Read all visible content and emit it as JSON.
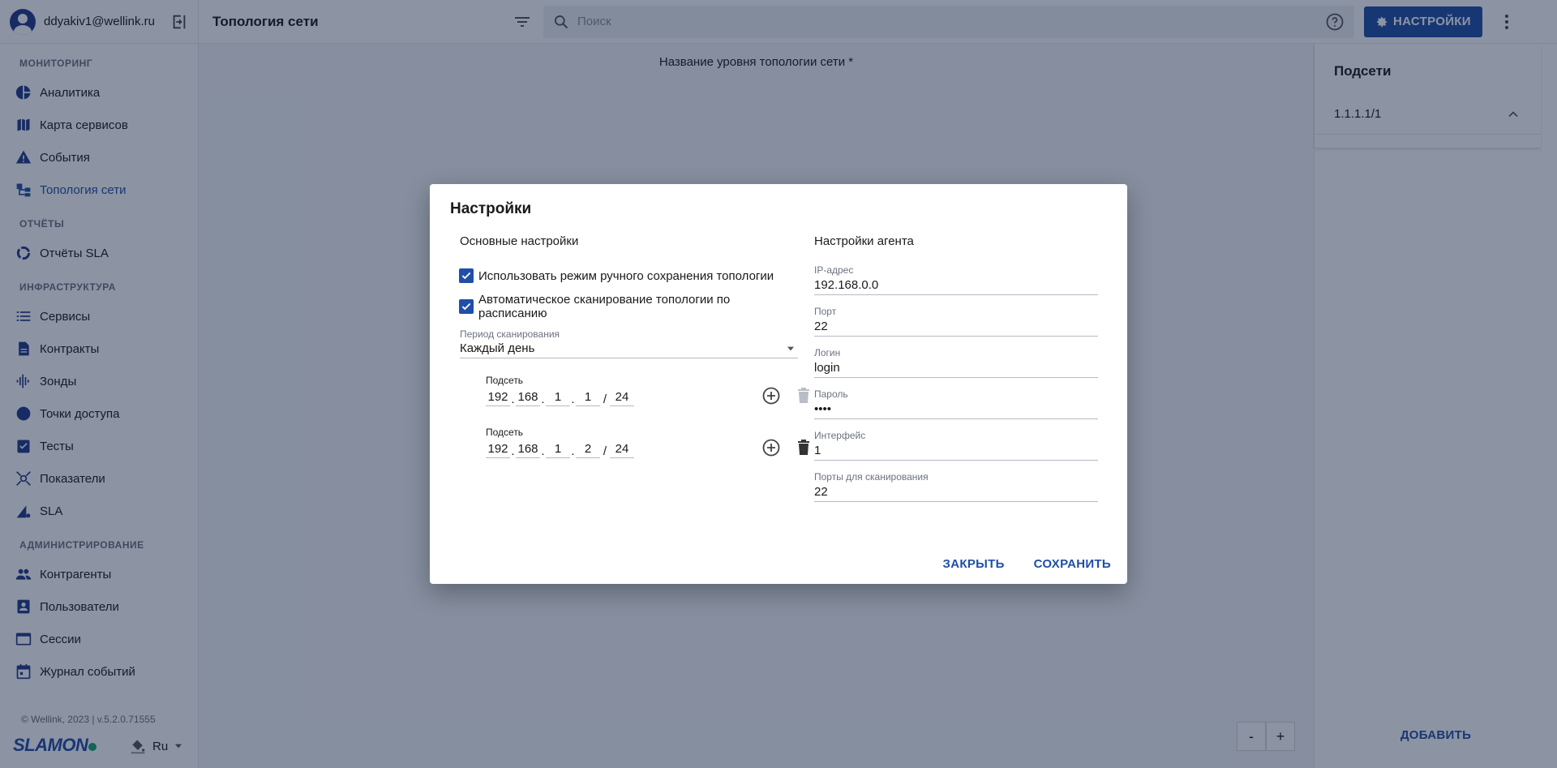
{
  "user": {
    "email": "ddyakiv1@wellink.ru"
  },
  "sidebar": {
    "sections": [
      {
        "title": "Мониторинг",
        "items": [
          {
            "label": "Аналитика",
            "icon": "pie-chart-icon"
          },
          {
            "label": "Карта сервисов",
            "icon": "map-icon"
          },
          {
            "label": "События",
            "icon": "warning-icon"
          },
          {
            "label": "Топология сети",
            "icon": "topology-icon",
            "active": true
          }
        ]
      },
      {
        "title": "Отчёты",
        "items": [
          {
            "label": "Отчёты SLA",
            "icon": "donut-icon"
          }
        ]
      },
      {
        "title": "Инфраструктура",
        "items": [
          {
            "label": "Сервисы",
            "icon": "list-icon"
          },
          {
            "label": "Контракты",
            "icon": "document-icon"
          },
          {
            "label": "Зонды",
            "icon": "signal-icon"
          },
          {
            "label": "Точки доступа",
            "icon": "circle-icon"
          },
          {
            "label": "Тесты",
            "icon": "clipboard-check-icon"
          },
          {
            "label": "Показатели",
            "icon": "hub-icon"
          },
          {
            "label": "SLA",
            "icon": "sla-icon"
          }
        ]
      },
      {
        "title": "Администрирование",
        "items": [
          {
            "label": "Контрагенты",
            "icon": "group-icon"
          },
          {
            "label": "Пользователи",
            "icon": "user-card-icon"
          },
          {
            "label": "Сессии",
            "icon": "window-icon"
          },
          {
            "label": "Журнал событий",
            "icon": "calendar-icon"
          }
        ]
      }
    ],
    "footer": "© Wellink, 2023 | v.5.2.0.71555",
    "brand": "SLAMON",
    "language": "Ru"
  },
  "header": {
    "title": "Топология сети",
    "search_placeholder": "Поиск",
    "settings_label": "НАСТРОЙКИ"
  },
  "main": {
    "level_name_label": "Название уровня топологии сети *",
    "zoom_out": "-",
    "zoom_in": "+"
  },
  "right_panel": {
    "title": "Подсети",
    "subnets": [
      "1.1.1.1/1"
    ],
    "add_label": "ДОБАВИТЬ"
  },
  "modal": {
    "title": "Настройки",
    "basic": {
      "heading": "Основные настройки",
      "manual_save_label": "Использовать режим ручного сохранения топологии",
      "auto_scan_label": "Автоматическое сканирование топологии по расписанию",
      "period_label": "Период сканирования",
      "period_value": "Каждый день",
      "subnet_label": "Подсеть",
      "subnets": [
        {
          "o1": "192",
          "o2": "168",
          "o3": "1",
          "o4": "1",
          "mask": "24"
        },
        {
          "o1": "192",
          "o2": "168",
          "o3": "1",
          "o4": "2",
          "mask": "24"
        }
      ]
    },
    "agent": {
      "heading": "Настройки агента",
      "fields": [
        {
          "label": "IP-адрес",
          "value": "192.168.0.0"
        },
        {
          "label": "Порт",
          "value": "22"
        },
        {
          "label": "Логин",
          "value": "login"
        },
        {
          "label": "Пароль",
          "value": "••••"
        },
        {
          "label": "Интерфейс",
          "value": "1"
        },
        {
          "label": "Порты для сканирования",
          "value": "22"
        }
      ]
    },
    "close_label": "ЗАКРЫТЬ",
    "save_label": "СОХРАНИТЬ"
  },
  "colors": {
    "accent": "#1f4fa8",
    "overlay": "#0f1e3c"
  }
}
